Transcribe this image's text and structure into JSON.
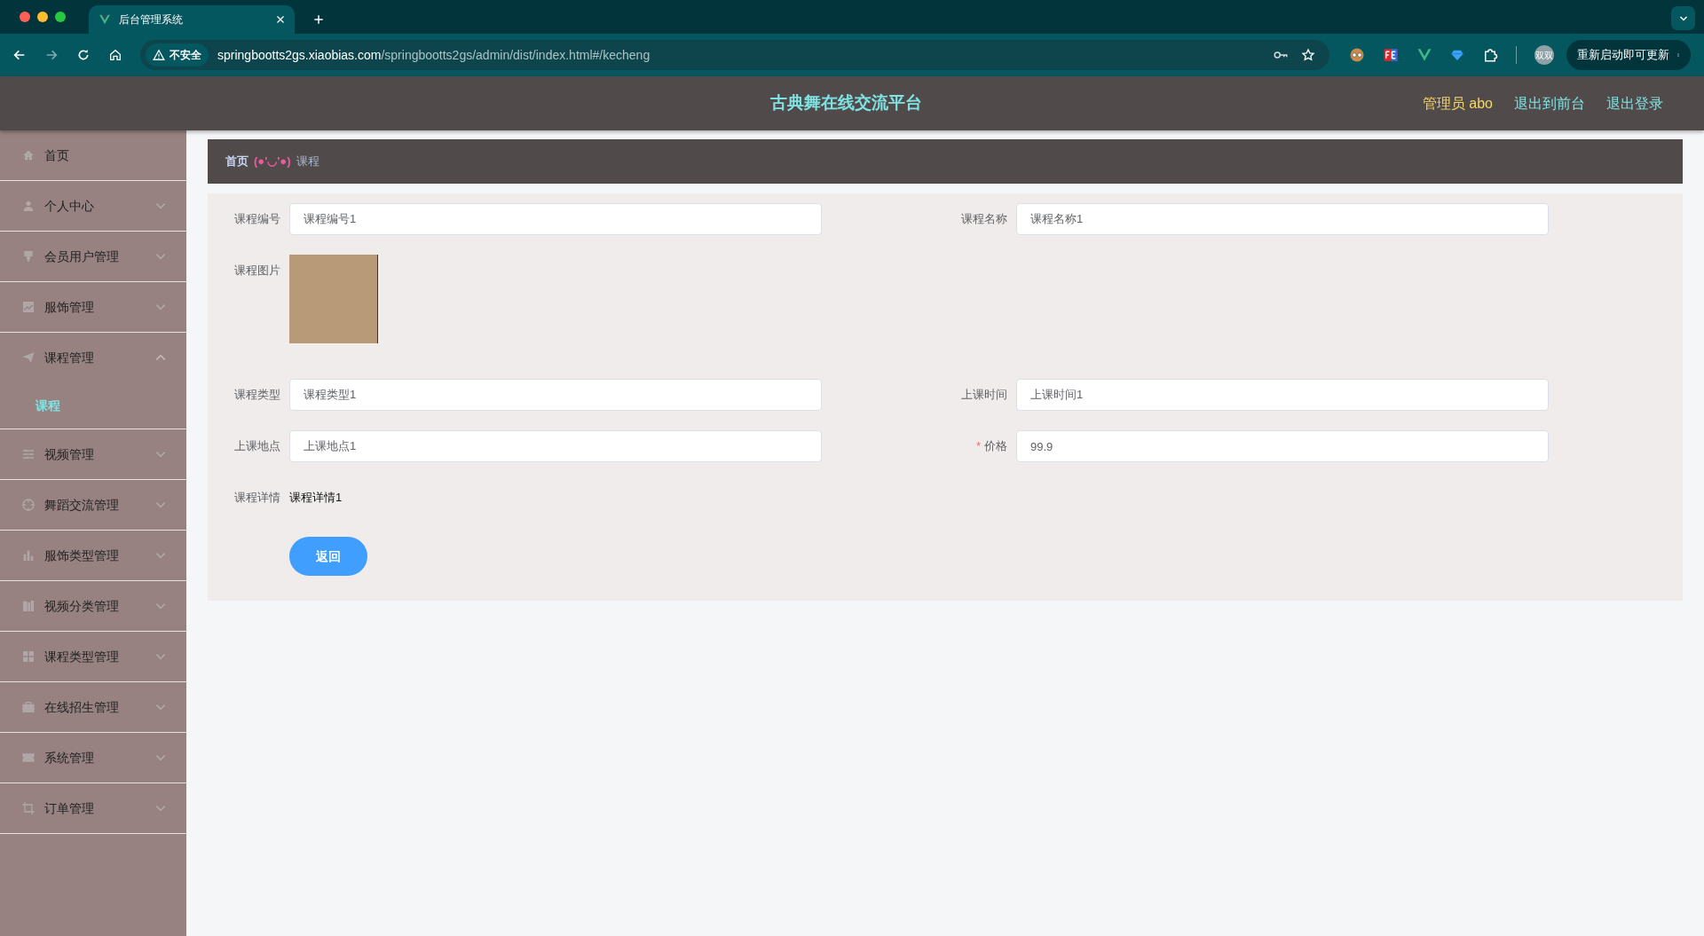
{
  "browser": {
    "tab_title": "后台管理系统",
    "security_label": "不安全",
    "url_host": "springbootts2gs.xiaobias.com",
    "url_path": "/springbootts2gs/admin/dist/index.html#/kecheng",
    "profile_label": "双双",
    "update_button": "重新启动即可更新"
  },
  "header": {
    "title": "古典舞在线交流平台",
    "user": "管理员 abo",
    "links": [
      "退出到前台",
      "退出登录"
    ]
  },
  "sidebar": {
    "items": [
      {
        "label": "首页",
        "kind": "link"
      },
      {
        "label": "个人中心",
        "kind": "group",
        "expanded": false
      },
      {
        "label": "会员用户管理",
        "kind": "group",
        "expanded": false
      },
      {
        "label": "服饰管理",
        "kind": "group",
        "expanded": false
      },
      {
        "label": "课程管理",
        "kind": "group",
        "expanded": true,
        "children": [
          {
            "label": "课程",
            "selected": true
          }
        ]
      },
      {
        "label": "视频管理",
        "kind": "group",
        "expanded": false
      },
      {
        "label": "舞蹈交流管理",
        "kind": "group",
        "expanded": false
      },
      {
        "label": "服饰类型管理",
        "kind": "group",
        "expanded": false
      },
      {
        "label": "视频分类管理",
        "kind": "group",
        "expanded": false
      },
      {
        "label": "课程类型管理",
        "kind": "group",
        "expanded": false
      },
      {
        "label": "在线招生管理",
        "kind": "group",
        "expanded": false
      },
      {
        "label": "系统管理",
        "kind": "group",
        "expanded": false
      },
      {
        "label": "订单管理",
        "kind": "group",
        "expanded": false
      }
    ]
  },
  "breadcrumb": {
    "home": "首页",
    "separator": "(●'◡'●)",
    "current": "课程"
  },
  "form": {
    "rows": [
      [
        {
          "kind": "input",
          "label": "课程编号",
          "value": "课程编号1"
        },
        {
          "kind": "input",
          "label": "课程名称",
          "value": "课程名称1"
        }
      ],
      [
        {
          "kind": "image",
          "label": "课程图片"
        }
      ],
      [
        {
          "kind": "input",
          "label": "课程类型",
          "value": "课程类型1"
        },
        {
          "kind": "input",
          "label": "上课时间",
          "value": "上课时间1"
        }
      ],
      [
        {
          "kind": "input",
          "label": "上课地点",
          "value": "上课地点1"
        },
        {
          "kind": "input",
          "label": "价格",
          "value": "99.9",
          "required_mark": "*"
        }
      ],
      [
        {
          "kind": "text",
          "label": "课程详情",
          "value": "课程详情1"
        }
      ]
    ],
    "back_button": "返回"
  }
}
